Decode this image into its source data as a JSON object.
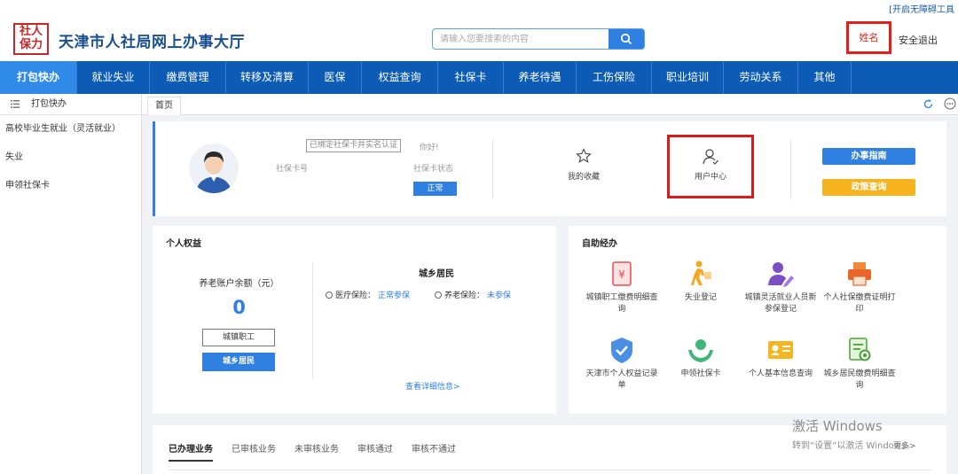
{
  "top": {
    "accessibility": "[开启无障碍工具"
  },
  "header": {
    "logo_lines": [
      "社人",
      "保力"
    ],
    "title": "天津市人社局网上办事大厅",
    "search_placeholder": "请输入您要搜索的内容",
    "username": "姓名",
    "logout": "安全退出"
  },
  "nav": {
    "items": [
      "打包快办",
      "就业失业",
      "缴费管理",
      "转移及清算",
      "医保",
      "权益查询",
      "社保卡",
      "养老待遇",
      "工伤保险",
      "职业培训",
      "劳动关系",
      "其他"
    ],
    "active_index": 0
  },
  "sidebar": {
    "header": "打包快办",
    "items": [
      "高校毕业生就业（灵活就业）",
      "失业",
      "申领社保卡"
    ]
  },
  "tabs": {
    "current": "首页"
  },
  "user_card": {
    "bind_tag": "已绑定社保卡并实名认证",
    "greeting": "你好!",
    "card_no_label": "社保卡号",
    "card_status_label": "社保卡状态",
    "card_status_value": "正常",
    "favorites": "我的收藏",
    "user_center": "用户中心",
    "guide_button": "办事指南",
    "policy_button": "政策查询"
  },
  "rights": {
    "title": "个人权益",
    "balance_label": "养老账户余额（元）",
    "balance_value": "0",
    "urban_button": "城镇职工",
    "rural_button": "城乡居民",
    "resident_title": "城乡居民",
    "medical_label": "医疗保险：",
    "medical_value": "正常参保",
    "pension_label": "养老保险：",
    "pension_value": "未参保",
    "details_link": "查看详细信息>"
  },
  "self_service": {
    "title": "自助经办",
    "items": [
      {
        "label": "城镇职工缴费明细查询",
        "icon": "receipt-icon"
      },
      {
        "label": "失业登记",
        "icon": "person-walking-icon"
      },
      {
        "label": "城镇灵活就业人员新参保登记",
        "icon": "user-edit-icon"
      },
      {
        "label": "个人社保缴费证明打印",
        "icon": "printer-icon"
      },
      {
        "label": "天津市个人权益记录单",
        "icon": "badge-check-icon"
      },
      {
        "label": "申领社保卡",
        "icon": "hands-card-icon"
      },
      {
        "label": "个人基本信息查询",
        "icon": "id-card-icon"
      },
      {
        "label": "城乡居民缴费明细查询",
        "icon": "document-search-icon"
      }
    ]
  },
  "bottom_tabs": {
    "items": [
      "已办理业务",
      "已审核业务",
      "未审核业务",
      "审核通过",
      "审核不通过"
    ],
    "more": "更多>"
  },
  "watermark": {
    "line1": "激活 Windows",
    "line2": "转到“设置”以激活 Windows。"
  },
  "colors": {
    "nav": "#0c5bb5",
    "accent": "#2f80e0",
    "highlight": "#d81b1b",
    "policy": "#f5b41e"
  }
}
